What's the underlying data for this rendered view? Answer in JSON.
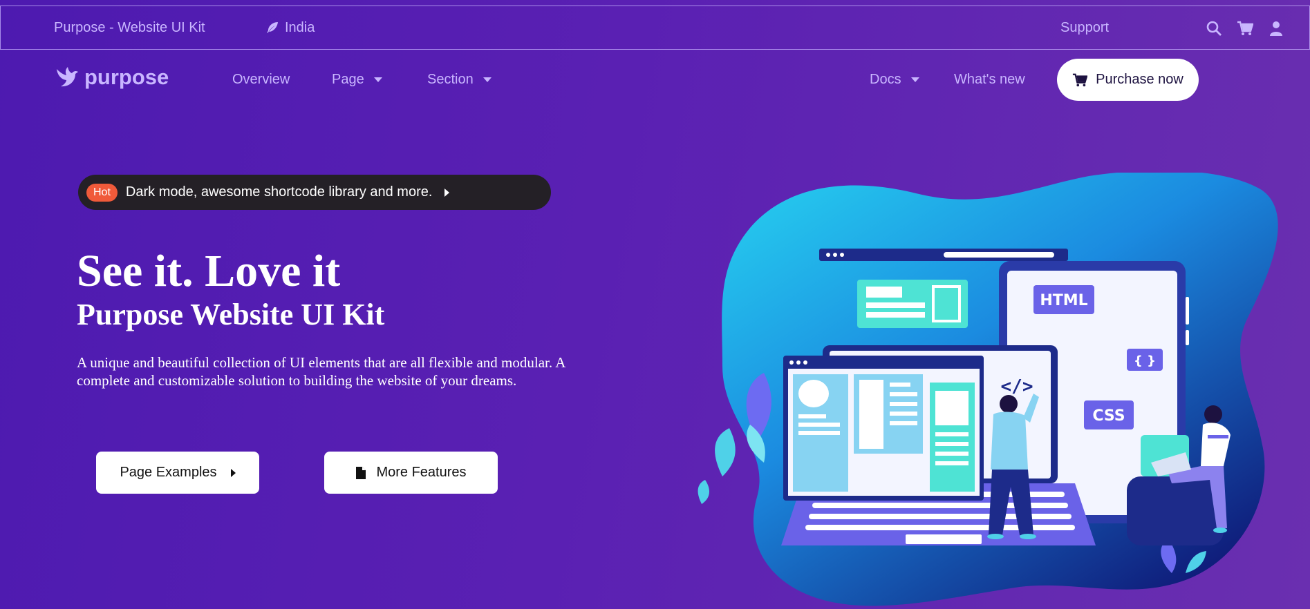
{
  "topbar": {
    "brand_text": "Purpose - Website UI Kit",
    "country": "India",
    "country_icon": "feather-icon",
    "support": "Support",
    "icons": [
      "search-icon",
      "cart-icon",
      "user-icon"
    ]
  },
  "navbar": {
    "logo_text": "purpose",
    "logo_icon": "bird-icon",
    "items": [
      {
        "label": "Overview"
      },
      {
        "label": "Page"
      },
      {
        "label": "Section"
      },
      {
        "label": "Docs"
      },
      {
        "label": "What's new"
      }
    ],
    "purchase_label": "Purchase now"
  },
  "hero": {
    "badge": "Hot",
    "promo_text": "Dark mode, awesome shortcode library and more.",
    "title": "See it. Love it",
    "subtitle": "Purpose Website UI Kit",
    "description": "A unique and beautiful collection of UI elements that are all flexible and modular. A complete and customizable solution to building the website of your dreams.",
    "btn_examples": "Page Examples",
    "btn_features": "More Features"
  },
  "illustration": {
    "labels": [
      "HTML",
      "{ }",
      "CSS",
      "</>"
    ]
  },
  "colors": {
    "background": "#5a20b3",
    "nav_text": "#c9b6ff",
    "hot_badge": "#f05a3a",
    "promo_bg": "#242026"
  }
}
